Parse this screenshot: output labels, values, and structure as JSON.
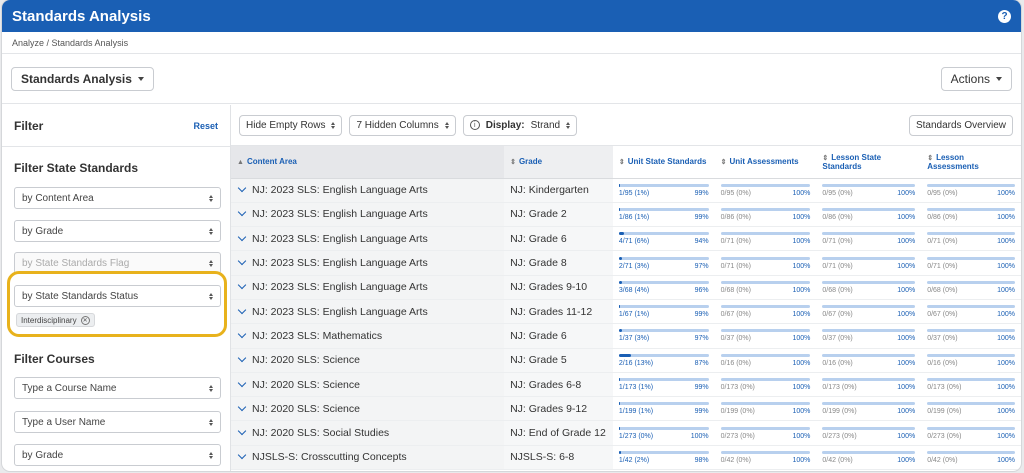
{
  "app": {
    "title": "Standards Analysis",
    "help_icon": "help-circle-icon"
  },
  "breadcrumb": "Analyze / Standards Analysis",
  "toolbar": {
    "view_select": "Standards Analysis",
    "actions": "Actions"
  },
  "filter": {
    "title": "Filter",
    "reset": "Reset",
    "state_section": "Filter State Standards",
    "selects": [
      {
        "label": "by Content Area",
        "disabled": false
      },
      {
        "label": "by Grade",
        "disabled": false
      },
      {
        "label": "by State Standards Flag",
        "disabled": true
      },
      {
        "label": "by State Standards Status",
        "disabled": false
      }
    ],
    "chip": "Interdisciplinary",
    "courses_section": "Filter Courses",
    "course_selects": [
      "Type a Course Name",
      "Type a User Name",
      "by Grade"
    ]
  },
  "content_toolbar": {
    "hide_empty": "Hide Empty Rows",
    "hidden_cols": "7 Hidden Columns",
    "display_label": "Display:",
    "display_value": "Strand",
    "standards_overview": "Standards Overview"
  },
  "table": {
    "headers": {
      "content_area": "Content Area",
      "grade": "Grade",
      "unit_state": "Unit State Standards",
      "unit_assess": "Unit Assessments",
      "lesson_state": "Lesson State Standards",
      "lesson_assess": "Lesson Assessments"
    },
    "rows": [
      {
        "area": "NJ: 2023 SLS: English Language Arts",
        "grade": "NJ: Kindergarten",
        "us": "1/95 (1%)",
        "us_pct": "99%",
        "us_fill": 0.01,
        "ua": "0/95 (0%)",
        "ls": "0/95 (0%)",
        "la": "0/95 (0%)"
      },
      {
        "area": "NJ: 2023 SLS: English Language Arts",
        "grade": "NJ: Grade 2",
        "us": "1/86 (1%)",
        "us_pct": "99%",
        "us_fill": 0.01,
        "ua": "0/86 (0%)",
        "ls": "0/86 (0%)",
        "la": "0/86 (0%)"
      },
      {
        "area": "NJ: 2023 SLS: English Language Arts",
        "grade": "NJ: Grade 6",
        "us": "4/71 (6%)",
        "us_pct": "94%",
        "us_fill": 0.06,
        "ua": "0/71 (0%)",
        "ls": "0/71 (0%)",
        "la": "0/71 (0%)"
      },
      {
        "area": "NJ: 2023 SLS: English Language Arts",
        "grade": "NJ: Grade 8",
        "us": "2/71 (3%)",
        "us_pct": "97%",
        "us_fill": 0.03,
        "ua": "0/71 (0%)",
        "ls": "0/71 (0%)",
        "la": "0/71 (0%)"
      },
      {
        "area": "NJ: 2023 SLS: English Language Arts",
        "grade": "NJ: Grades 9-10",
        "us": "3/68 (4%)",
        "us_pct": "96%",
        "us_fill": 0.04,
        "ua": "0/68 (0%)",
        "ls": "0/68 (0%)",
        "la": "0/68 (0%)"
      },
      {
        "area": "NJ: 2023 SLS: English Language Arts",
        "grade": "NJ: Grades 11-12",
        "us": "1/67 (1%)",
        "us_pct": "99%",
        "us_fill": 0.01,
        "ua": "0/67 (0%)",
        "ls": "0/67 (0%)",
        "la": "0/67 (0%)"
      },
      {
        "area": "NJ: 2023 SLS: Mathematics",
        "grade": "NJ: Grade 6",
        "us": "1/37 (3%)",
        "us_pct": "97%",
        "us_fill": 0.03,
        "ua": "0/37 (0%)",
        "ls": "0/37 (0%)",
        "la": "0/37 (0%)"
      },
      {
        "area": "NJ: 2020 SLS: Science",
        "grade": "NJ: Grade 5",
        "us": "2/16 (13%)",
        "us_pct": "87%",
        "us_fill": 0.13,
        "ua": "0/16 (0%)",
        "ls": "0/16 (0%)",
        "la": "0/16 (0%)"
      },
      {
        "area": "NJ: 2020 SLS: Science",
        "grade": "NJ: Grades 6-8",
        "us": "1/173 (1%)",
        "us_pct": "99%",
        "us_fill": 0.01,
        "ua": "0/173 (0%)",
        "ls": "0/173 (0%)",
        "la": "0/173 (0%)"
      },
      {
        "area": "NJ: 2020 SLS: Science",
        "grade": "NJ: Grades 9-12",
        "us": "1/199 (1%)",
        "us_pct": "99%",
        "us_fill": 0.01,
        "ua": "0/199 (0%)",
        "ls": "0/199 (0%)",
        "la": "0/199 (0%)"
      },
      {
        "area": "NJ: 2020 SLS: Social Studies",
        "grade": "NJ: End of Grade 12",
        "us": "1/273 (0%)",
        "us_pct": "100%",
        "us_fill": 0.005,
        "ua": "0/273 (0%)",
        "ls": "0/273 (0%)",
        "la": "0/273 (0%)"
      },
      {
        "area": "NJSLS-S: Crosscutting Concepts",
        "grade": "NJSLS-S: 6-8",
        "us": "1/42 (2%)",
        "us_pct": "98%",
        "us_fill": 0.02,
        "ua": "0/42 (0%)",
        "ls": "0/42 (0%)",
        "la": "0/42 (0%)"
      }
    ],
    "full_pct": "100%"
  }
}
